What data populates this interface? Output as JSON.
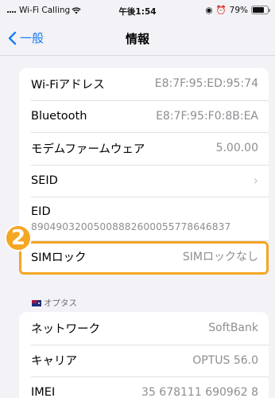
{
  "status_bar": {
    "carrier": "Wi-Fi Calling",
    "time": "午後1:54",
    "battery_percent": "79%",
    "battery_level": 0.79
  },
  "nav": {
    "back_label": "一般",
    "title": "情報"
  },
  "group1": [
    {
      "label": "Wi-Fiアドレス",
      "value": "E8:7F:95:ED:95:74"
    },
    {
      "label": "Bluetooth",
      "value": "E8:7F:95:F0:8B:EA"
    },
    {
      "label": "モデムファームウェア",
      "value": "5.00.00"
    },
    {
      "label": "SEID",
      "value": ""
    },
    {
      "label": "EID",
      "value": "89049032005008882600055778646837"
    },
    {
      "label": "SIMロック",
      "value": "SIMロックなし"
    }
  ],
  "section2_header": "オプタス",
  "group2": [
    {
      "label": "ネットワーク",
      "value": "SoftBank"
    },
    {
      "label": "キャリア",
      "value": "OPTUS 56.0"
    },
    {
      "label": "IMEI",
      "value": "35 678111 690962 8"
    }
  ],
  "annotation": {
    "step_number": "2",
    "accent_color": "#f5a623"
  },
  "colors": {
    "link": "#1a7cf5",
    "background": "#f2f2f7"
  }
}
